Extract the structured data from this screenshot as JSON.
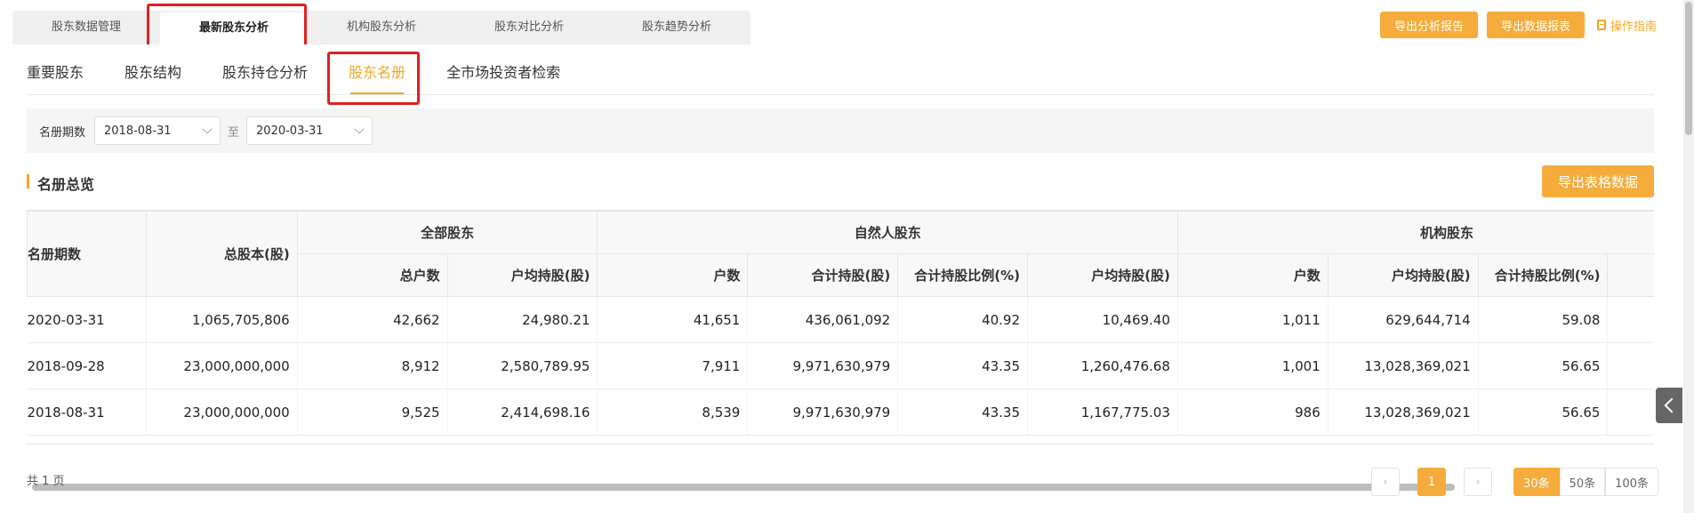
{
  "top_tabs": [
    "股东数据管理",
    "最新股东分析",
    "机构股东分析",
    "股东对比分析",
    "股东趋势分析"
  ],
  "top_actions": {
    "export_report": "导出分析报告",
    "export_data": "导出数据报表",
    "guide": "操作指南"
  },
  "sub_tabs": [
    "重要股东",
    "股东结构",
    "股东持仓分析",
    "股东名册",
    "全市场投资者检索"
  ],
  "filter": {
    "label": "名册期数",
    "start": "2018-08-31",
    "to": "至",
    "end": "2020-03-31"
  },
  "section": {
    "title": "名册总览",
    "export_btn": "导出表格数据"
  },
  "table": {
    "col_period": "名册期数",
    "col_total_shares": "总股本(股)",
    "group_all": "全部股东",
    "group_natural": "自然人股东",
    "group_inst": "机构股东",
    "sub_headers": [
      "总户数",
      "户均持股(股)",
      "户数",
      "合计持股(股)",
      "合计持股比例(%)",
      "户均持股(股)",
      "户数",
      "户均持股(股)",
      "合计持股比例(%)"
    ],
    "rows": [
      [
        "2020-03-31",
        "1,065,705,806",
        "42,662",
        "24,980.21",
        "41,651",
        "436,061,092",
        "40.92",
        "10,469.40",
        "1,011",
        "629,644,714",
        "59.08"
      ],
      [
        "2018-09-28",
        "23,000,000,000",
        "8,912",
        "2,580,789.95",
        "7,911",
        "9,971,630,979",
        "43.35",
        "1,260,476.68",
        "1,001",
        "13,028,369,021",
        "56.65"
      ],
      [
        "2018-08-31",
        "23,000,000,000",
        "9,525",
        "2,414,698.16",
        "8,539",
        "9,971,630,979",
        "43.35",
        "1,167,775.03",
        "986",
        "13,028,369,021",
        "56.65"
      ]
    ]
  },
  "footer": {
    "count": "共 1 页",
    "prev": "‹",
    "page": "1",
    "next": "›",
    "sizes": [
      "30条",
      "50条",
      "100条"
    ]
  },
  "colors": {
    "accent": "#f5ac3b",
    "highlight": "#e02020"
  }
}
